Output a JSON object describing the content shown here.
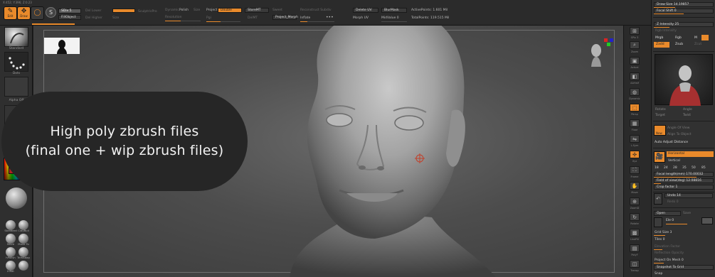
{
  "coords": "X:452; Y:396; Z:0.23",
  "toolbar": {
    "edit_label": "Edit",
    "draw_label": "Draw",
    "sdiv": "SDiv 5",
    "lower_res": "Del Lower",
    "fill_object": "FillObject",
    "del_higher": "Del Higher",
    "mrgb": "Mrgb",
    "sculptris_pro": "SculptrisPro",
    "dynamic": "Dynamic",
    "polish": "Polish",
    "size": "Size",
    "resolution": "Resolution",
    "project": "Project",
    "double": "Double",
    "store_mt": "StoreMT",
    "sweet": "Sweet",
    "reconstruct_subdiv": "Reconstruct Subdiv",
    "delete_uv": "Delete UV",
    "blur_mask": "BlurMask",
    "active_points": "ActivePoints: 1.601 Mil",
    "total_points": "TotalPoints: 119.515 Mil",
    "pgi": "Pgi",
    "del_mt": "DelMT",
    "project_morph": "Project_Morph",
    "inflate": "Inflate",
    "morph_uv": "Morph UV",
    "mid_value": "MidValue 0"
  },
  "left": {
    "brush_label": "Standard",
    "stroke_label": "Dots",
    "alpha_label": "Alpha Off",
    "texture_label": "Texture Off",
    "material_label": "MatCap Gray",
    "brushes": [
      "Standard",
      "ClayBuil",
      "Move",
      "Move To",
      "hPolish",
      "TrimAdap",
      "Inflat",
      "Pinch"
    ]
  },
  "banner": {
    "line1": "High poly zbrush files",
    "line2": "(final one + wip zbrush files)"
  },
  "righttool": {
    "labels": [
      "SPix 3",
      "Zoom",
      "Actual",
      "AAHalf",
      "Dynamic",
      "Persp",
      "Floor",
      "L.Sym",
      "Xyz",
      "Frame",
      "Move",
      "ZoomD",
      "Rotate",
      "LineFill",
      "PolyF",
      "Transp",
      "Ghost",
      "Solo",
      "Xpose"
    ]
  },
  "right": {
    "draw_size": "Draw Size 14.19857",
    "focal_shift": "Focal Shift 0",
    "z_intensity": "Z Intensity 25",
    "rgb_intensity": "Rgb Intensity",
    "mrgb": "Mrgb",
    "rgb": "Rgb",
    "m": "M",
    "zadd": "Zadd",
    "zsub": "Zsub",
    "zcut": "Zcut",
    "rotate_label": "Rotate",
    "angle_label": "Angle",
    "target_label": "Target",
    "twist_label": "Twist",
    "new_label": "New",
    "angle_of_view": "Angle Of View",
    "align_to_object": "Align To Object",
    "auto_adjust_distance": "Auto Adjust Distance",
    "horizontal": "Horizontal",
    "vertical": "Vertical",
    "focal_values": [
      "18",
      "24",
      "28",
      "35",
      "50",
      "85"
    ],
    "focal_length": "Focal length(mm) 170.00032",
    "field_of_view": "Field of view(deg) 12.08816",
    "crop_factor": "Crop factor 1",
    "undo": "Undo 14",
    "redo": "Redo 0",
    "open": "Open",
    "save": "Save",
    "ele": "Ele 0",
    "grid_size": "Grid Size 3",
    "tiles": "Tiles 0",
    "elevation": "Elevation Factor",
    "reflection": "Reflection Opacity",
    "project_on_mesh": "Project On Mesh 0",
    "snapshot_to_grid": "Snapshot To Grid",
    "snap": "Snap"
  },
  "colors": {
    "accent": "#e98a2b",
    "panel": "#2f2f2f",
    "viewport": "#4d4d4d",
    "banner": "#262626"
  }
}
